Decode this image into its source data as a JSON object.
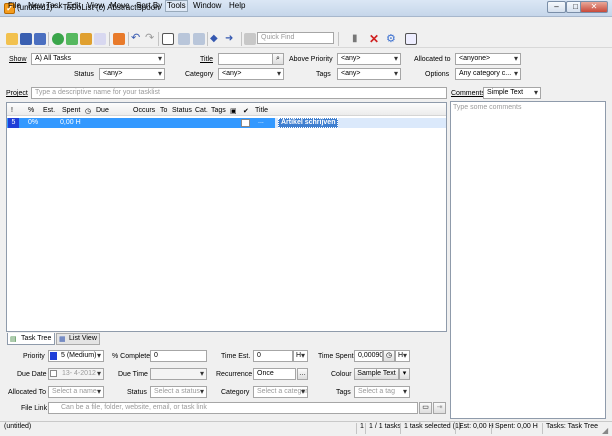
{
  "window": {
    "title": "(untitled1)* - ToDoList (c) AbstractSpoon"
  },
  "menu": [
    "File",
    "New Task",
    "Edit",
    "View",
    "Move",
    "Sort By",
    "Tools",
    "Window",
    "Help"
  ],
  "toolbar": {
    "quick_find_placeholder": "Quick Find"
  },
  "filters": {
    "show_label": "Show",
    "show_value": "A)  All Tasks",
    "title_label": "Title",
    "title_value": "",
    "above_priority_label": "Above Priority",
    "above_priority_value": "<any>",
    "allocated_to_label": "Allocated to",
    "allocated_to_value": "<anyone>",
    "status_label": "Status",
    "status_value": "<any>",
    "category_label": "Category",
    "category_value": "<any>",
    "tags_label": "Tags",
    "tags_value": "<any>",
    "options_label": "Options",
    "options_value": "Any category c..."
  },
  "project": {
    "label": "Project",
    "placeholder": "Type a descriptive name for your tasklist"
  },
  "comments": {
    "label": "Comments",
    "format_value": "Simple Text",
    "placeholder": "Type some comments"
  },
  "task_columns": [
    "!",
    "%",
    "Est.",
    "Spent",
    "Due",
    "Occurs",
    "To",
    "Status",
    "Cat.",
    "Tags",
    "Title"
  ],
  "tasks": [
    {
      "priority": "5",
      "percent": "0%",
      "spent": "0,00 H",
      "subtask_marker": "...",
      "title": "Artikel schrijven"
    }
  ],
  "view_tabs": [
    "Task Tree",
    "List View"
  ],
  "attributes": {
    "priority_label": "Priority",
    "priority_value": "5 (Medium)",
    "percent_label": "% Complete",
    "percent_value": "0",
    "time_est_label": "Time Est.",
    "time_est_value": "0",
    "time_est_unit": "H",
    "time_spent_label": "Time Spent",
    "time_spent_value": "0,00090",
    "time_spent_unit": "H",
    "due_date_label": "Due Date",
    "due_date_value": "13-  4-2012",
    "due_time_label": "Due Time",
    "recurrence_label": "Recurrence",
    "recurrence_value": "Once",
    "colour_label": "Colour",
    "colour_value": "Sample Text",
    "allocated_to_label": "Allocated To",
    "allocated_to_placeholder": "Select a name",
    "status_label": "Status",
    "status_placeholder": "Select a status",
    "category_label": "Category",
    "category_placeholder": "Select a category",
    "tags_label": "Tags",
    "tags_placeholder": "Select a tag",
    "file_link_label": "File Link",
    "file_link_placeholder": "Can be a file, folder, website, email, or task link"
  },
  "status_bar": {
    "file": "(untitled)",
    "count1": "1",
    "tasks": "1 / 1 tasks",
    "selected": "1 task selected (1)",
    "est": "Est: 0,00 H",
    "spent": "Spent: 0,00 H",
    "view": "Tasks: Task Tree"
  },
  "colors": {
    "priority_blue": "#1f3fd8",
    "selection_blue": "#3399ff",
    "title_selected_bg": "#3f7fd0"
  }
}
